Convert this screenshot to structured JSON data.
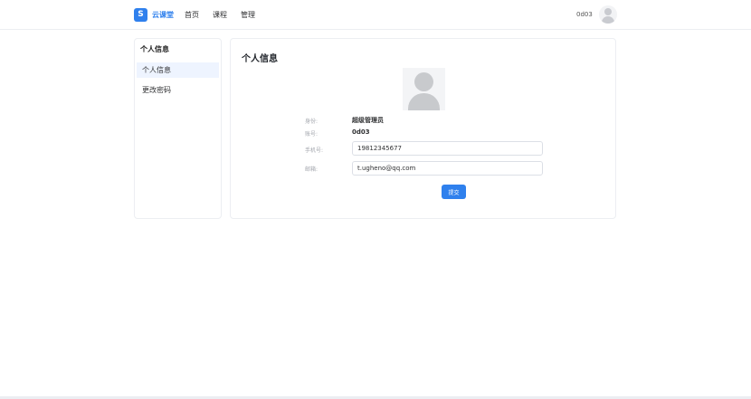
{
  "header": {
    "logo_letter": "S",
    "brand_name": "云课堂",
    "nav": [
      {
        "label": "首页"
      },
      {
        "label": "课程"
      },
      {
        "label": "管理"
      }
    ],
    "username": "0d03",
    "avatar_icon": "user-avatar-icon"
  },
  "sidebar": {
    "title": "个人信息",
    "items": [
      {
        "label": "个人信息",
        "active": true
      },
      {
        "label": "更改密码",
        "active": false
      }
    ]
  },
  "profile": {
    "title": "个人信息",
    "avatar_icon": "user-avatar-icon",
    "role_label": "身份:",
    "role_value": "超级管理员",
    "account_label": "账号:",
    "account_value": "0d03",
    "phone_label": "手机号:",
    "phone_value": "19812345677",
    "email_label": "邮箱:",
    "email_value": "t.ugheno@qq.com",
    "submit_label": "提交"
  },
  "colors": {
    "accent": "#2f80ed",
    "active_bg": "#eef4ff",
    "border": "#eceef2"
  }
}
